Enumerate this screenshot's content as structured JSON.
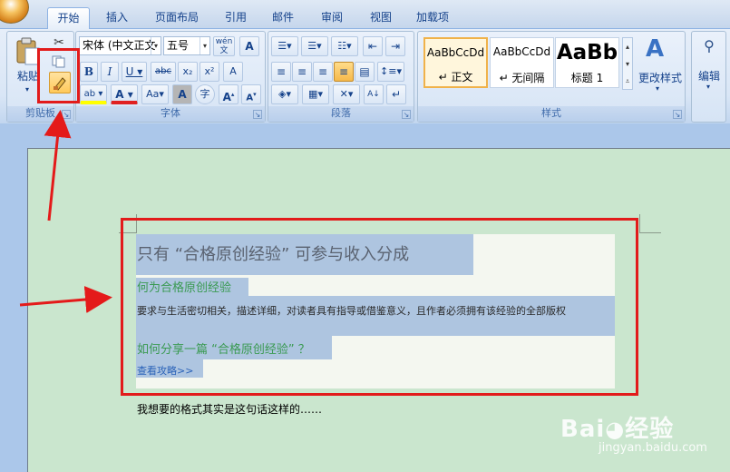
{
  "tabs": [
    "开始",
    "插入",
    "页面布局",
    "引用",
    "邮件",
    "审阅",
    "视图",
    "加载项"
  ],
  "clipboard": {
    "paste_label": "粘贴",
    "group_label": "剪贴板"
  },
  "font": {
    "font_name": "宋体 (中文正文",
    "font_size": "五号",
    "wen_label": "wén",
    "a_label": "A",
    "bold": "B",
    "italic": "I",
    "underline": "U",
    "strike": "abc",
    "sub": "x₂",
    "sup": "x²",
    "clear": "A",
    "highlight": "ab",
    "color_a": "A",
    "case": "Aa",
    "shade_a": "A",
    "enclose": "字",
    "grow": "A",
    "shrink": "A",
    "group_label": "字体"
  },
  "paragraph": {
    "group_label": "段落",
    "sort_label": "A↓"
  },
  "styles": {
    "items": [
      {
        "sample": "AaBbCcDd",
        "name": "↵ 正文",
        "selected": true
      },
      {
        "sample": "AaBbCcDd",
        "name": "↵ 无间隔",
        "selected": false
      },
      {
        "sample": "AaBb",
        "name": "标题 1",
        "selected": false
      }
    ],
    "change_label": "更改样式",
    "group_label": "样式"
  },
  "editing": {
    "label": "编辑"
  },
  "document": {
    "title_line": "只有 “合格原创经验” 可参与收入分成",
    "heading1": "何为合格原创经验",
    "body_line": "要求与生活密切相关，描述详细，对读者具有指导或借鉴意义，且作者必须拥有该经验的全部版权",
    "heading2": "如何分享一篇 “合格原创经验” ？",
    "link": "查看攻略>>",
    "note": "我想要的格式其实是这句话这样的……"
  },
  "watermark": {
    "brand": "Bai",
    "brand2": "经验",
    "url": "jingyan.baidu.com"
  },
  "colors": {
    "annotation": "#e21b1b",
    "page_bg": "#cae6ce",
    "selection": "#aec5e0"
  }
}
